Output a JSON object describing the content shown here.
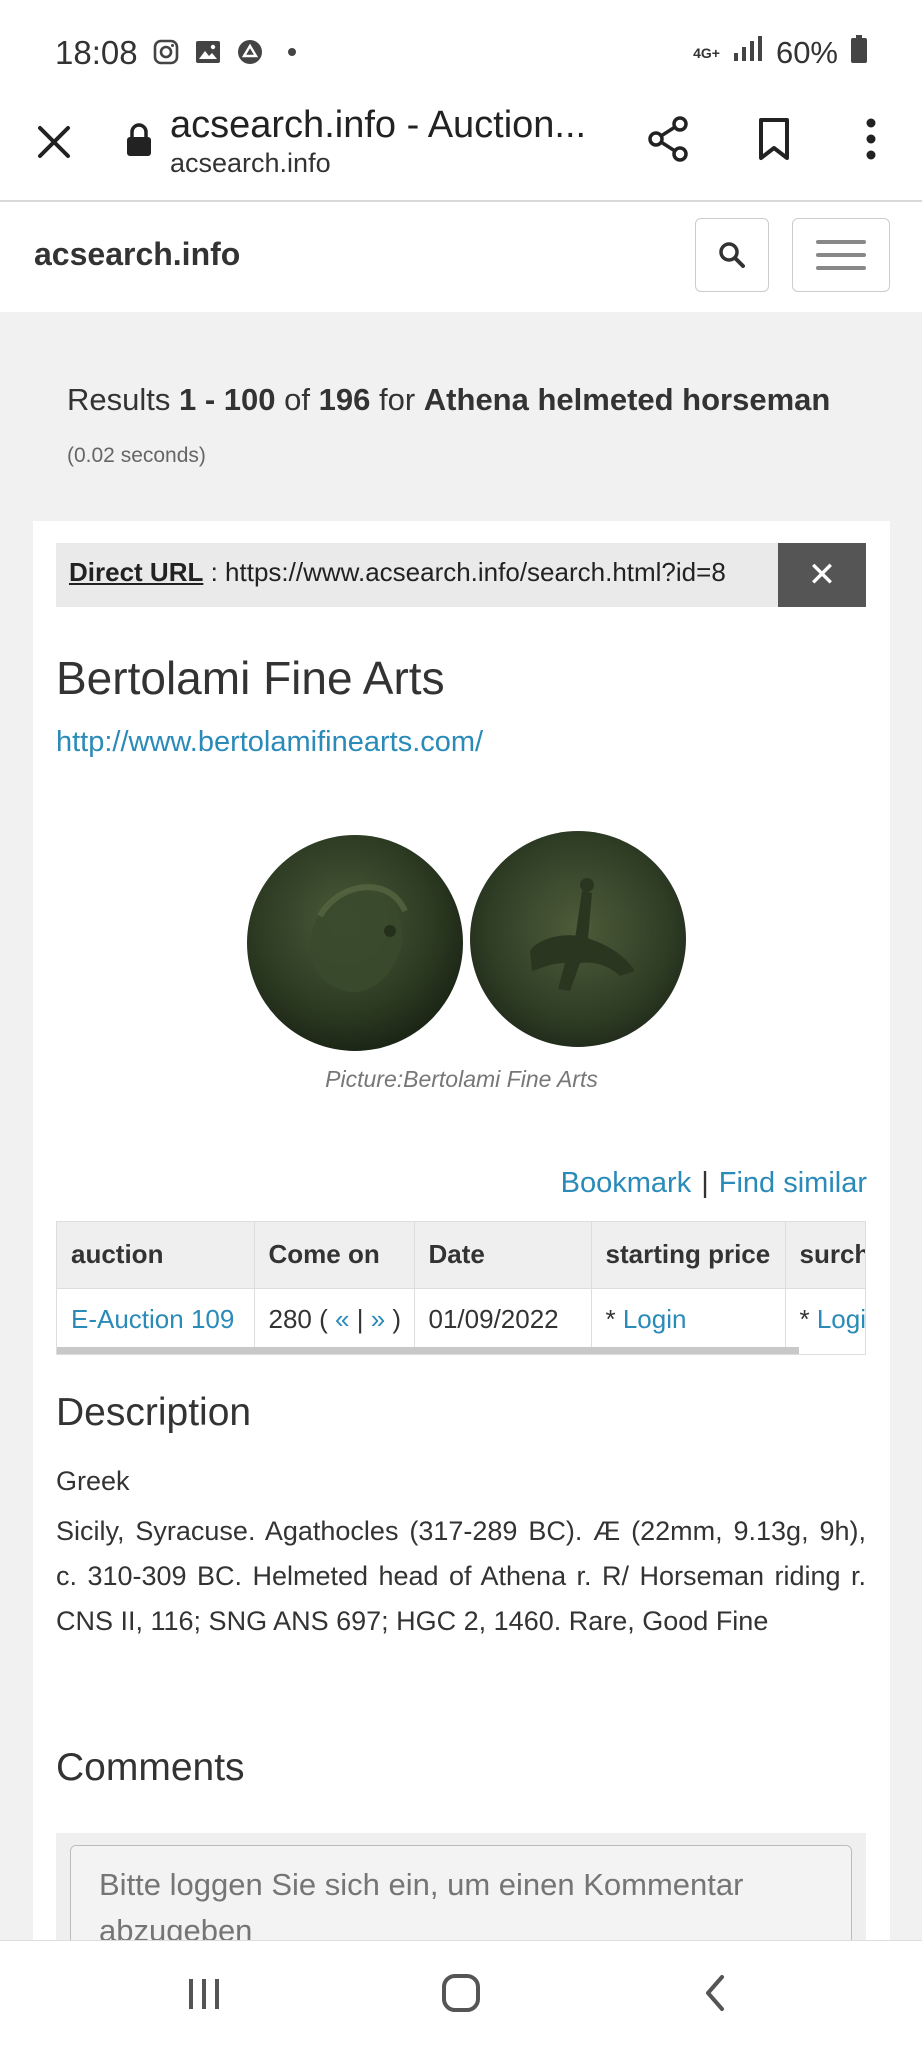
{
  "status_bar": {
    "time": "18:08",
    "network": "4G+",
    "battery": "60%",
    "icons": [
      "instagram-icon",
      "gallery-icon",
      "app-icon",
      "dot-icon",
      "signal-icon",
      "battery-icon"
    ]
  },
  "browser": {
    "page_title": "acsearch.info - Auction...",
    "domain": "acsearch.info"
  },
  "site": {
    "brand": "acsearch.info"
  },
  "results": {
    "prefix": "Results",
    "range": "1 - 100",
    "of_label": "of",
    "total": "196",
    "for_label": "for",
    "query": "Athena helmeted horseman",
    "timing": "(0.02 seconds)"
  },
  "direct_url": {
    "label": "Direct URL",
    "separator": " : ",
    "value": "https://www.acsearch.info/search.html?id=8",
    "close": "✕"
  },
  "lot": {
    "house_name": "Bertolami Fine Arts",
    "house_url": "http://www.bertolamifinearts.com/",
    "picture_caption": "Picture:Bertolami Fine Arts",
    "bookmark": "Bookmark",
    "action_separator": "|",
    "find_similar": "Find similar"
  },
  "table": {
    "headers": [
      "auction",
      "Come on",
      "Date",
      "starting price",
      "surch"
    ],
    "row": {
      "auction": "E-Auction 109",
      "lot_number": "280 (",
      "prev": "«",
      "pipe": "|",
      "next": "»",
      "lot_close": ")",
      "date": "01/09/2022",
      "start_prefix": "* ",
      "start_login": "Login",
      "surch_prefix": "* ",
      "surch_login": "Logi"
    }
  },
  "description": {
    "heading": "Description",
    "category": "Greek",
    "text": "Sicily, Syracuse. Agathocles (317-289 BC). Æ (22mm, 9.13g, 9h), c. 310-309 BC. Helmeted head of Athena r. R/ Horseman riding r. CNS II, 116; SNG ANS 697; HGC 2, 1460. Rare, Good Fine"
  },
  "comments": {
    "heading": "Comments",
    "placeholder": "Bitte loggen Sie sich ein, um einen Kommentar abzugeben"
  },
  "colors": {
    "link": "#2a8ab8",
    "close_button": "#555555",
    "page_bg": "#f1f1f1"
  }
}
